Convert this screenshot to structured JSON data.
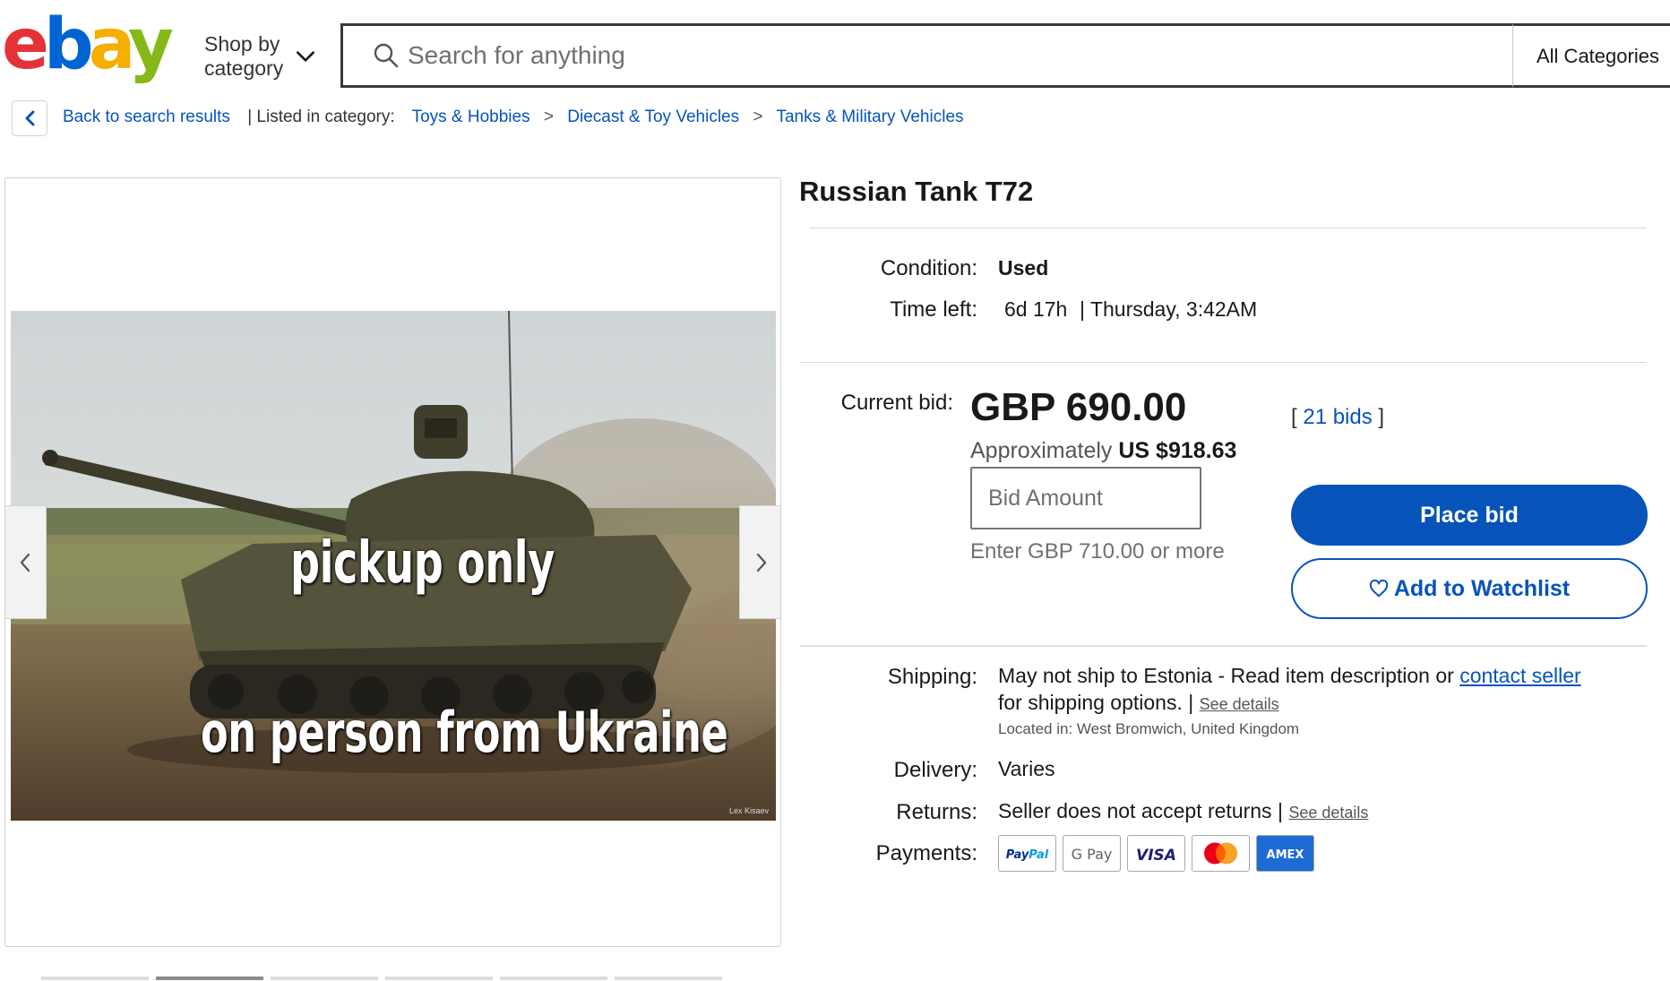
{
  "header": {
    "shop_by_line1": "Shop by",
    "shop_by_line2": "category",
    "search_placeholder": "Search for anything",
    "category_select": "All Categories"
  },
  "breadcrumb": {
    "back_label": "Back to search results",
    "listed_label": "| Listed in category:",
    "categories": [
      "Toys & Hobbies",
      "Diecast & Toy Vehicles",
      "Tanks & Military Vehicles"
    ],
    "separator": ">"
  },
  "gallery": {
    "caption_top": "pickup only",
    "caption_bottom": "on person from Ukraine",
    "photo_credit": "Lex Kisaev"
  },
  "item": {
    "title": "Russian Tank T72",
    "condition_label": "Condition:",
    "condition_value": "Used",
    "time_left_label": "Time left:",
    "time_left_value": "6d 17h",
    "time_left_end": "| Thursday, 3:42AM"
  },
  "bidding": {
    "current_bid_label": "Current bid:",
    "price": "GBP 690.00",
    "approx_prefix": "Approximately",
    "approx_value": "US $918.63",
    "bids_open": "[",
    "bids_link": "21 bids",
    "bids_close": "]",
    "bid_placeholder": "Bid Amount",
    "enter_note": "Enter GBP 710.00 or more",
    "place_bid": "Place bid",
    "watchlist": "Add to Watchlist"
  },
  "shipping": {
    "shipping_label": "Shipping:",
    "shipping_text": "May not ship to Estonia - Read item description or",
    "contact_seller": "contact seller",
    "shipping_text2": "for shipping options. |",
    "see_details": "See details",
    "located_label": "Located in:",
    "located_value": "West Bromwich, United Kingdom",
    "delivery_label": "Delivery:",
    "delivery_value": "Varies",
    "returns_label": "Returns:",
    "returns_value": "Seller does not accept returns |",
    "returns_see_details": "See details",
    "payments_label": "Payments:",
    "payment_methods": [
      "PayPal",
      "G Pay",
      "VISA",
      "Mastercard",
      "AMEX"
    ]
  },
  "colors": {
    "brand_blue": "#0654ba",
    "ebay_red": "#e53238",
    "ebay_blue": "#0064d2",
    "ebay_yellow": "#f5af02",
    "ebay_green": "#86b817"
  }
}
